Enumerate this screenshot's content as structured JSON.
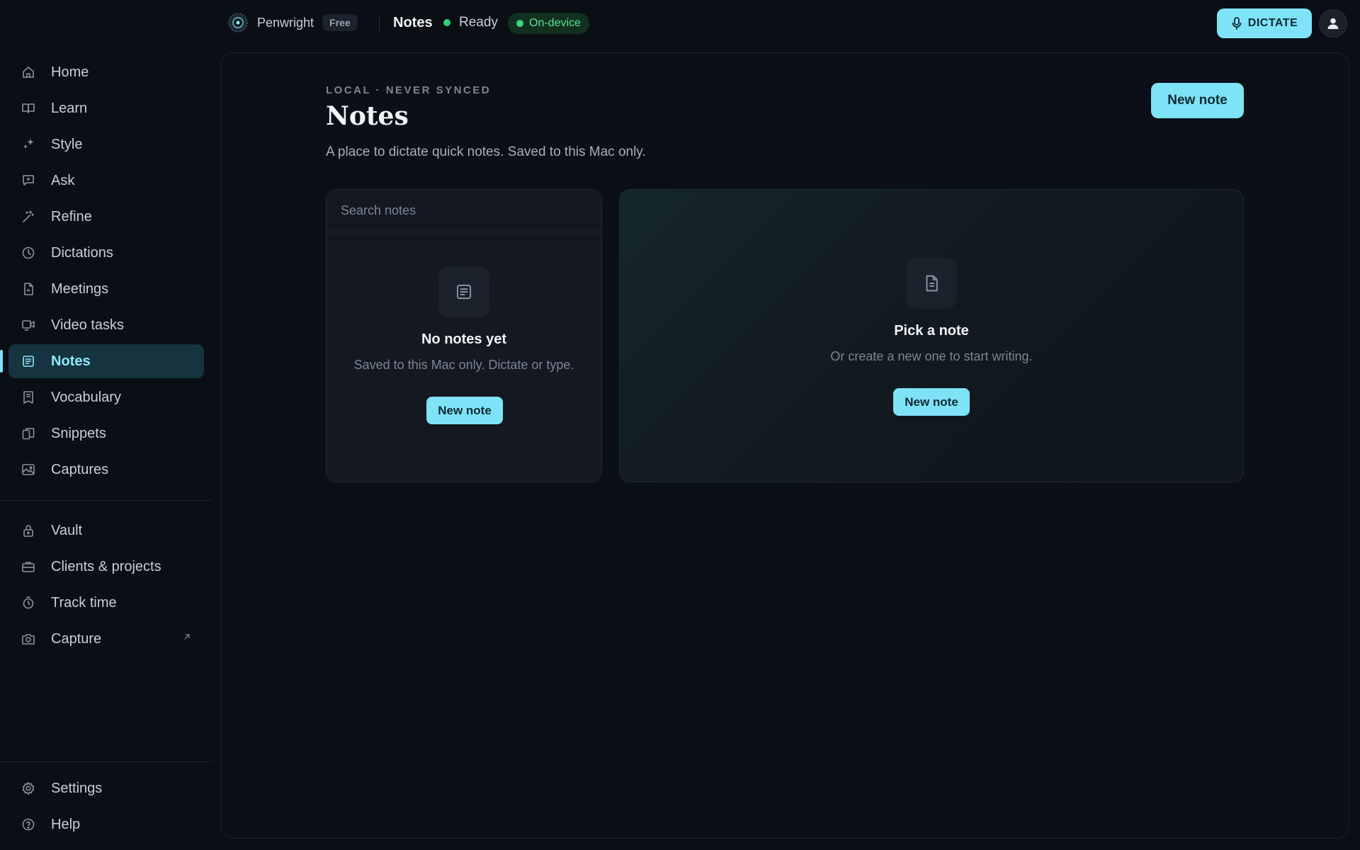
{
  "topbar": {
    "app_name": "Penwright",
    "plan": "Free",
    "page": "Notes",
    "status": "Ready",
    "mode": "On-device",
    "dictate_label": "DICTATE"
  },
  "sidebar": {
    "items": [
      {
        "label": "Home",
        "icon": "home-icon"
      },
      {
        "label": "Learn",
        "icon": "book-icon"
      },
      {
        "label": "Style",
        "icon": "sparkles-icon"
      },
      {
        "label": "Ask",
        "icon": "chat-icon"
      },
      {
        "label": "Refine",
        "icon": "magic-icon"
      },
      {
        "label": "Dictations",
        "icon": "clock-icon"
      },
      {
        "label": "Meetings",
        "icon": "document-icon"
      },
      {
        "label": "Video tasks",
        "icon": "video-icon"
      },
      {
        "label": "Notes",
        "icon": "notes-icon",
        "active": true
      },
      {
        "label": "Vocabulary",
        "icon": "bookmark-icon"
      },
      {
        "label": "Snippets",
        "icon": "copy-icon"
      },
      {
        "label": "Captures",
        "icon": "image-icon"
      }
    ],
    "secondary": [
      {
        "label": "Vault",
        "icon": "lock-icon"
      },
      {
        "label": "Clients & projects",
        "icon": "briefcase-icon"
      },
      {
        "label": "Track time",
        "icon": "stopwatch-icon"
      },
      {
        "label": "Capture",
        "icon": "camera-icon",
        "external": true
      }
    ],
    "footer": [
      {
        "label": "Settings",
        "icon": "gear-icon"
      },
      {
        "label": "Help",
        "icon": "help-icon"
      }
    ]
  },
  "main": {
    "eyebrow": "LOCAL · NEVER SYNCED",
    "title": "Notes",
    "subtitle": "A place to dictate quick notes. Saved to this Mac only.",
    "new_note_label": "New note",
    "list": {
      "search_placeholder": "Search notes",
      "empty_title": "No notes yet",
      "empty_sub": "Saved to this Mac only. Dictate or type.",
      "button_label": "New note"
    },
    "editor": {
      "empty_title": "Pick a note",
      "empty_sub": "Or create a new one to start writing.",
      "button_label": "New note"
    }
  },
  "colors": {
    "accent": "#7fe3f7",
    "status_green": "#2fd27a",
    "background": "#0a0e15"
  }
}
